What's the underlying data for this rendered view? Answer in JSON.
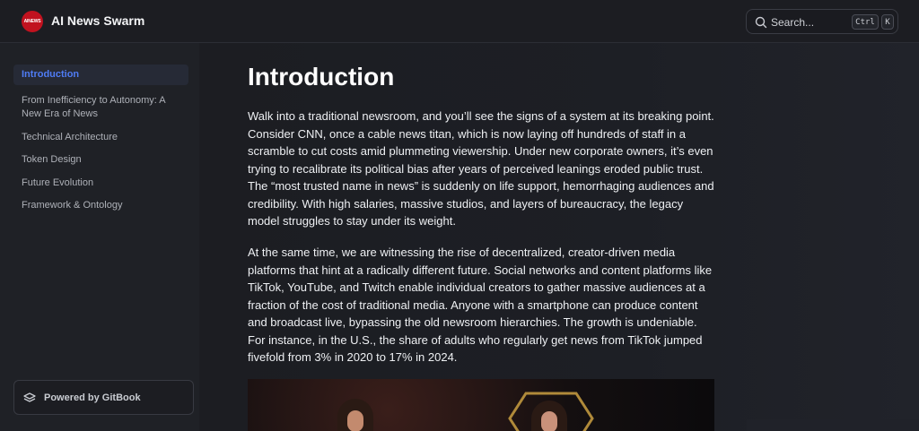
{
  "header": {
    "logo_text": "AINEWS",
    "brand": "AI News Swarm",
    "search_label": "Search...",
    "shortcut_ctrl": "Ctrl",
    "shortcut_key": "K"
  },
  "sidebar": {
    "items": [
      {
        "label": "Introduction",
        "active": true
      },
      {
        "label": "From Inefficiency to Autonomy: A New Era of News",
        "active": false
      },
      {
        "label": "Technical Architecture",
        "active": false
      },
      {
        "label": "Token Design",
        "active": false
      },
      {
        "label": "Future Evolution",
        "active": false
      },
      {
        "label": "Framework & Ontology",
        "active": false
      }
    ],
    "powered_by": "Powered by GitBook"
  },
  "content": {
    "title": "Introduction",
    "paragraphs": [
      "Walk into a traditional newsroom, and you’ll see the signs of a system at its breaking point. Consider CNN, once a cable news titan, which is now laying off hundreds of staff in a scramble to cut costs amid plummeting viewership. Under new corporate owners, it’s even trying to recalibrate its political bias after years of perceived leanings eroded public trust. The “most trusted name in news” is suddenly on life support, hemorrhaging audiences and credibility. With high salaries, massive studios, and layers of bureaucracy, the legacy model struggles to stay under its weight.",
      "At the same time, we are witnessing the rise of decentralized, creator-driven media platforms that hint at a radically different future. Social networks and content platforms like TikTok, YouTube, and Twitch enable individual creators to gather massive audiences at a fraction of the cost of traditional media. Anyone with a smartphone can produce content and broadcast live, bypassing the old newsroom hierarchies. The growth is undeniable. For instance, in the U.S., the share of adults who regularly get news from TikTok jumped fivefold from 3% in 2020 to 17% in 2024."
    ]
  },
  "colors": {
    "accent": "#4f7cf5",
    "logo": "#c1121f",
    "background": "#1b1c21"
  },
  "icons": {
    "search": "search-icon",
    "gitbook": "gitbook-icon"
  }
}
